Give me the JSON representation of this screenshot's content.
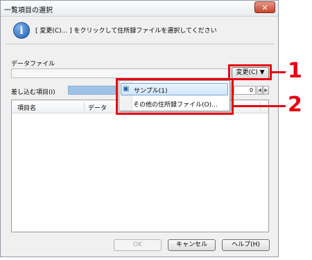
{
  "window": {
    "title": "一覧項目の選択",
    "close_icon": "close-icon",
    "close_glyph": "✕"
  },
  "info": {
    "icon": "info-icon",
    "glyph": "i",
    "text": "[ 変更(C)... ] をクリックして住所録ファイルを選択してください"
  },
  "data_file": {
    "label": "データファイル",
    "value": "",
    "change_button": "変更(C) ▼"
  },
  "fields": {
    "label": "差し込む項目(I)",
    "count": "0",
    "spin_left_icon": "chevron-left-icon",
    "spin_right_icon": "chevron-right-icon"
  },
  "table": {
    "columns": [
      "項目名",
      "データ"
    ],
    "rows": []
  },
  "dropdown_menu": {
    "items": [
      {
        "label": "サンプル(1)",
        "icon": "address-book-icon",
        "highlighted": true
      },
      {
        "label": "その他の住所録ファイル(O)...",
        "icon": "",
        "highlighted": false
      }
    ]
  },
  "buttons": {
    "ok": "OK",
    "cancel": "キャンセル",
    "help": "ヘルプ(H)"
  },
  "callouts": {
    "first": "1",
    "second": "2",
    "color": "#e60012"
  }
}
